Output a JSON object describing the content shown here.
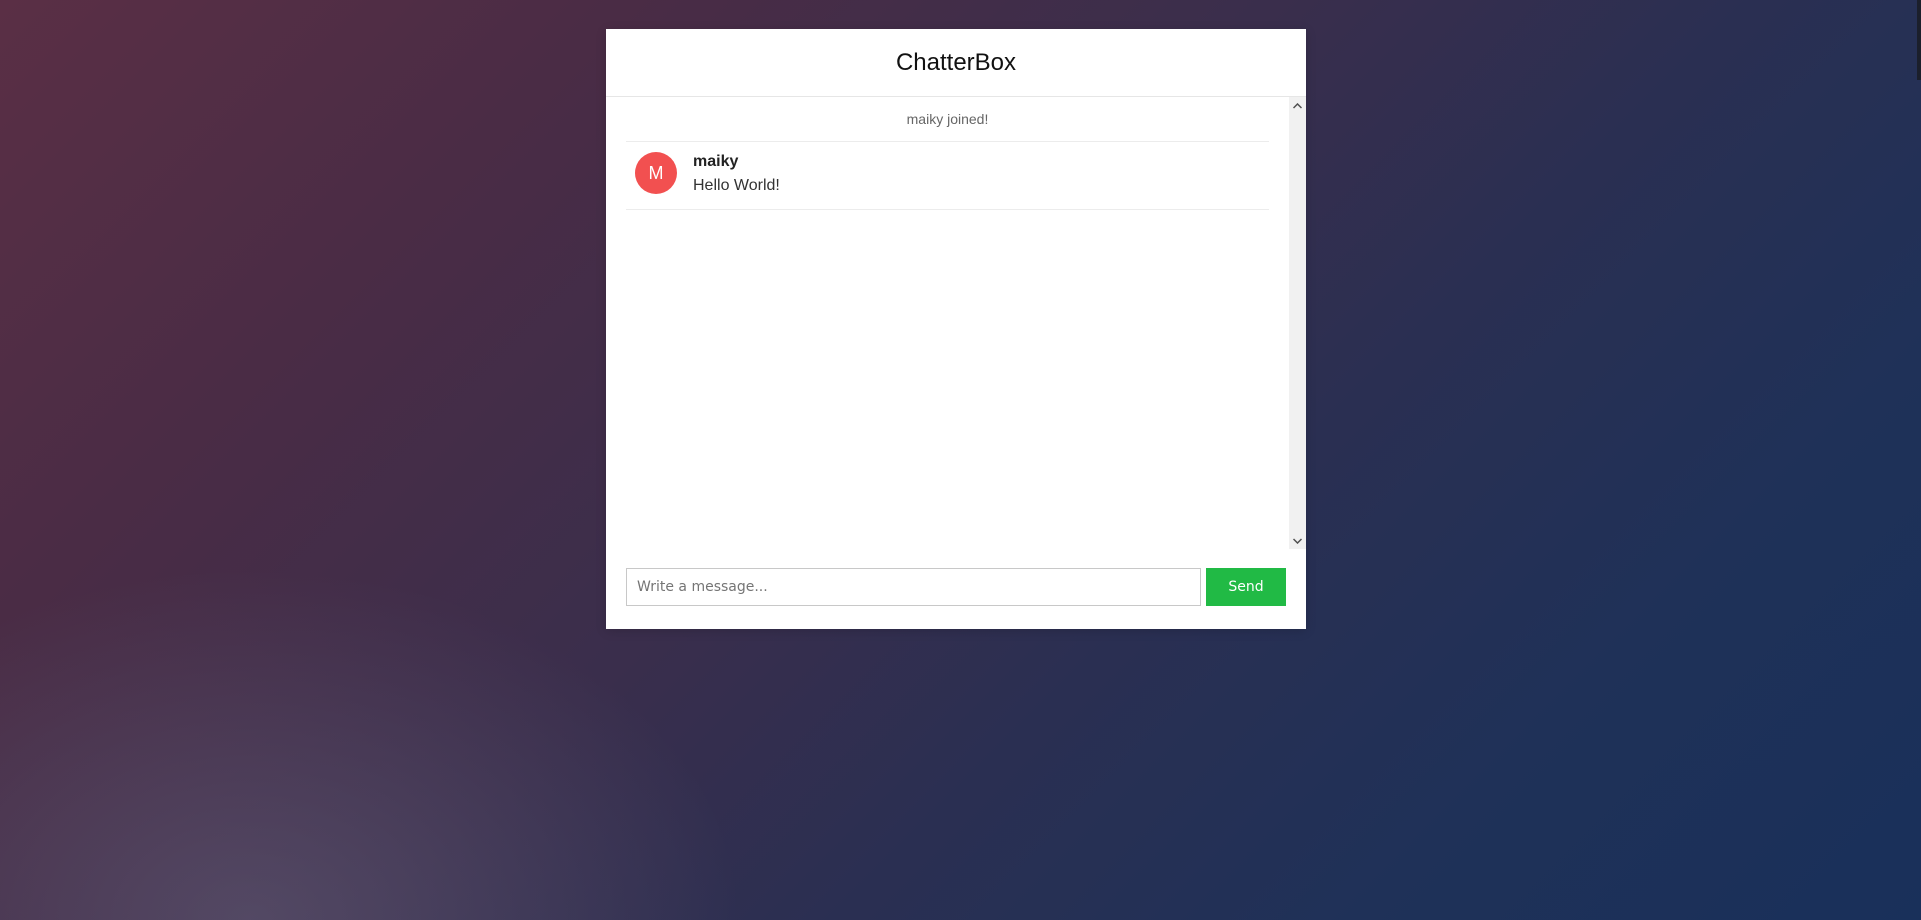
{
  "app": {
    "title": "ChatterBox"
  },
  "messages": {
    "system": "maiky joined!",
    "items": [
      {
        "avatar_initial": "M",
        "avatar_color": "#f25050",
        "author": "maiky",
        "text": "Hello World!"
      }
    ]
  },
  "composer": {
    "placeholder": "Write a message...",
    "value": "",
    "send_label": "Send",
    "send_color": "#21ba45"
  },
  "scrollbar": {
    "up_icon": "chevron-up-icon",
    "down_icon": "chevron-down-icon"
  }
}
